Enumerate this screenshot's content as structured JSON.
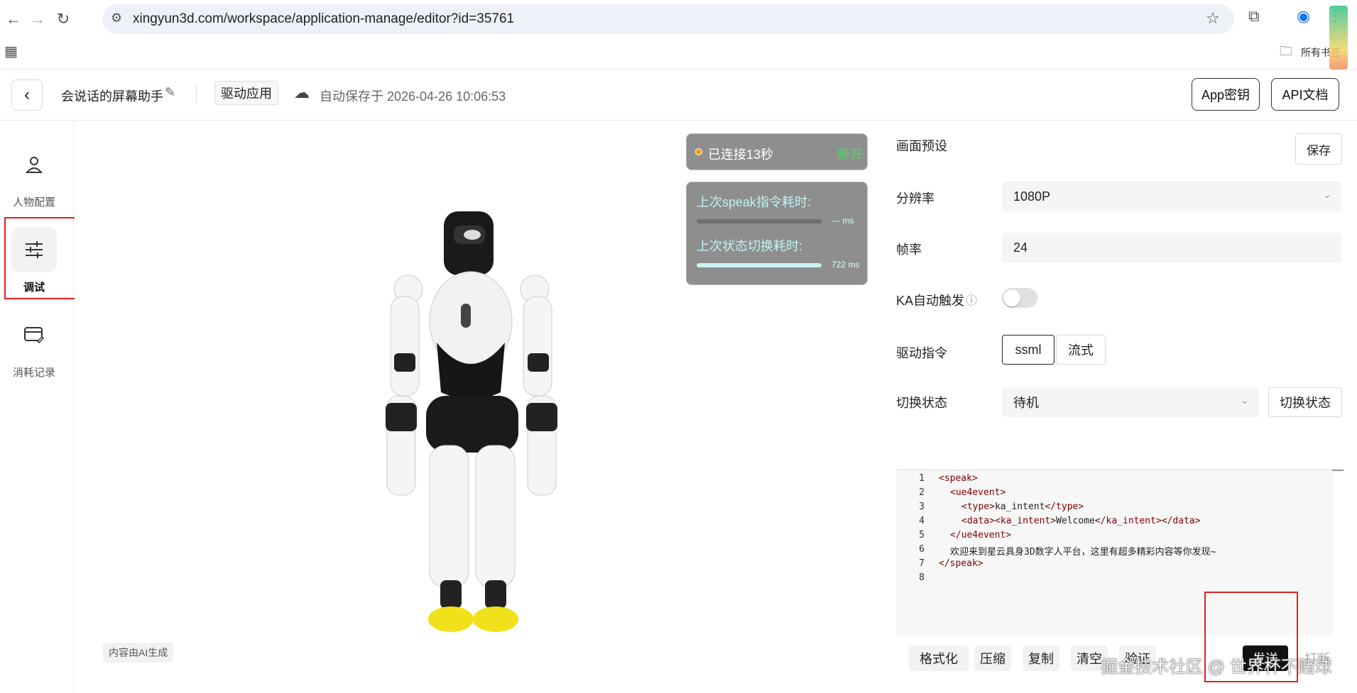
{
  "browser": {
    "url": "xingyun3d.com/workspace/application-manage/editor?id=35761",
    "bookmarks_label": "所有书签"
  },
  "header": {
    "app_name": "会说话的屏幕助手",
    "tag": "驱动应用",
    "autosave": "自动保存于 2026-04-26 10:06:53",
    "app_key_button": "App密钥",
    "api_docs_button": "API文档"
  },
  "sidebar": {
    "items": [
      {
        "label": "人物配置",
        "icon": "person-icon"
      },
      {
        "label": "调试",
        "icon": "sliders-icon"
      },
      {
        "label": "消耗记录",
        "icon": "card-icon"
      }
    ]
  },
  "preview": {
    "ai_badge": "内容由AI生成",
    "connection": {
      "status_text": "已连接13秒",
      "disconnect_label": "断开"
    },
    "metrics": {
      "speak_label": "上次speak指令耗时:",
      "speak_value": "--- ms",
      "speak_progress": 0.0,
      "switch_label": "上次状态切换耗时:",
      "switch_value": "722 ms",
      "switch_progress": 1.0
    }
  },
  "panel": {
    "section_title": "画面预设",
    "save_button": "保存",
    "resolution_label": "分辨率",
    "resolution_value": "1080P",
    "framerate_label": "帧率",
    "framerate_value": "24",
    "ka_label": "KA自动触发",
    "ka_enabled": false,
    "drive_label": "驱动指令",
    "drive_options": [
      "ssml",
      "流式"
    ],
    "drive_selected": "ssml",
    "state_label": "切换状态",
    "state_value": "待机",
    "state_button": "切换状态",
    "editor_lines": [
      {
        "n": "1",
        "indent": 0,
        "parts": [
          [
            "tag",
            "<speak>"
          ]
        ]
      },
      {
        "n": "2",
        "indent": 1,
        "parts": [
          [
            "tag",
            "<ue4event>"
          ]
        ]
      },
      {
        "n": "3",
        "indent": 2,
        "parts": [
          [
            "tag",
            "<type>"
          ],
          [
            "txt",
            "ka_intent"
          ],
          [
            "tag",
            "</type>"
          ]
        ]
      },
      {
        "n": "4",
        "indent": 2,
        "parts": [
          [
            "tag",
            "<data>"
          ],
          [
            "tag",
            "<ka_intent>"
          ],
          [
            "txt",
            "Welcome"
          ],
          [
            "tag",
            "</ka_intent>"
          ],
          [
            "tag",
            "</data>"
          ]
        ]
      },
      {
        "n": "5",
        "indent": 1,
        "parts": [
          [
            "tag",
            "</ue4event>"
          ]
        ]
      },
      {
        "n": "6",
        "indent": 1,
        "parts": [
          [
            "txt",
            "欢迎来到星云具身3D数字人平台，这里有超多精彩内容等你发现~"
          ]
        ]
      },
      {
        "n": "7",
        "indent": 0,
        "parts": [
          [
            "tag",
            "</speak>"
          ]
        ]
      },
      {
        "n": "8",
        "indent": 0,
        "parts": []
      }
    ],
    "toolbar": {
      "format": "格式化",
      "compress": "压缩",
      "copy": "复制",
      "clear": "清空",
      "validate": "验证",
      "send": "发送",
      "interrupt": "打断"
    }
  },
  "watermark": "掘金技术社区 @ 世界杯不赌球"
}
